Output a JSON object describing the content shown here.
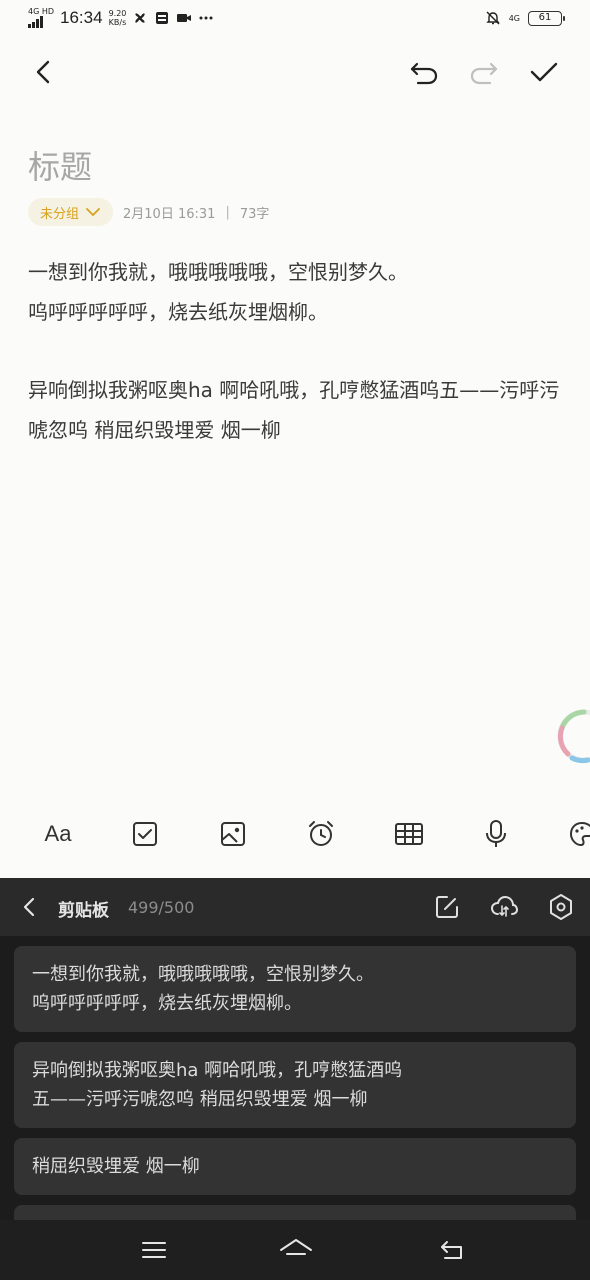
{
  "status_bar": {
    "network_type": "4G HD",
    "time": "16:34",
    "net_speed_value": "9.20",
    "net_speed_unit": "KB/s",
    "right_network": "4G",
    "battery": "61"
  },
  "note": {
    "title_placeholder": "标题",
    "group_label": "未分组",
    "date": "2月10日 16:31",
    "separator": "|",
    "word_count": "73字",
    "paragraphs": [
      "一想到你我就，哦哦哦哦哦，空恨别梦久。",
      "呜呼呼呼呼呼，烧去纸灰埋烟柳。",
      "异响倒拟我粥呕奥ha 啊哈吼哦，孔哼憋猛酒呜五——污呼污唬忽呜 稍屈织毁埋爱 烟一柳"
    ]
  },
  "format_toolbar": {
    "font_label": "Aa"
  },
  "clipboard": {
    "title": "剪贴板",
    "count": "499/500",
    "items": [
      "一想到你我就，哦哦哦哦哦，空恨别梦久。\n呜呼呼呼呼呼，烧去纸灰埋烟柳。",
      "异响倒拟我粥呕奥ha 啊哈吼哦，孔哼憋猛酒呜\n五——污呼污唬忽呜 稍屈织毁埋爱 烟一柳",
      "稍屈织毁埋爱 烟一柳"
    ]
  },
  "colors": {
    "accent_yellow": "#d6a21e",
    "panel_dark": "#1c1c1c",
    "panel_item": "#333333"
  }
}
